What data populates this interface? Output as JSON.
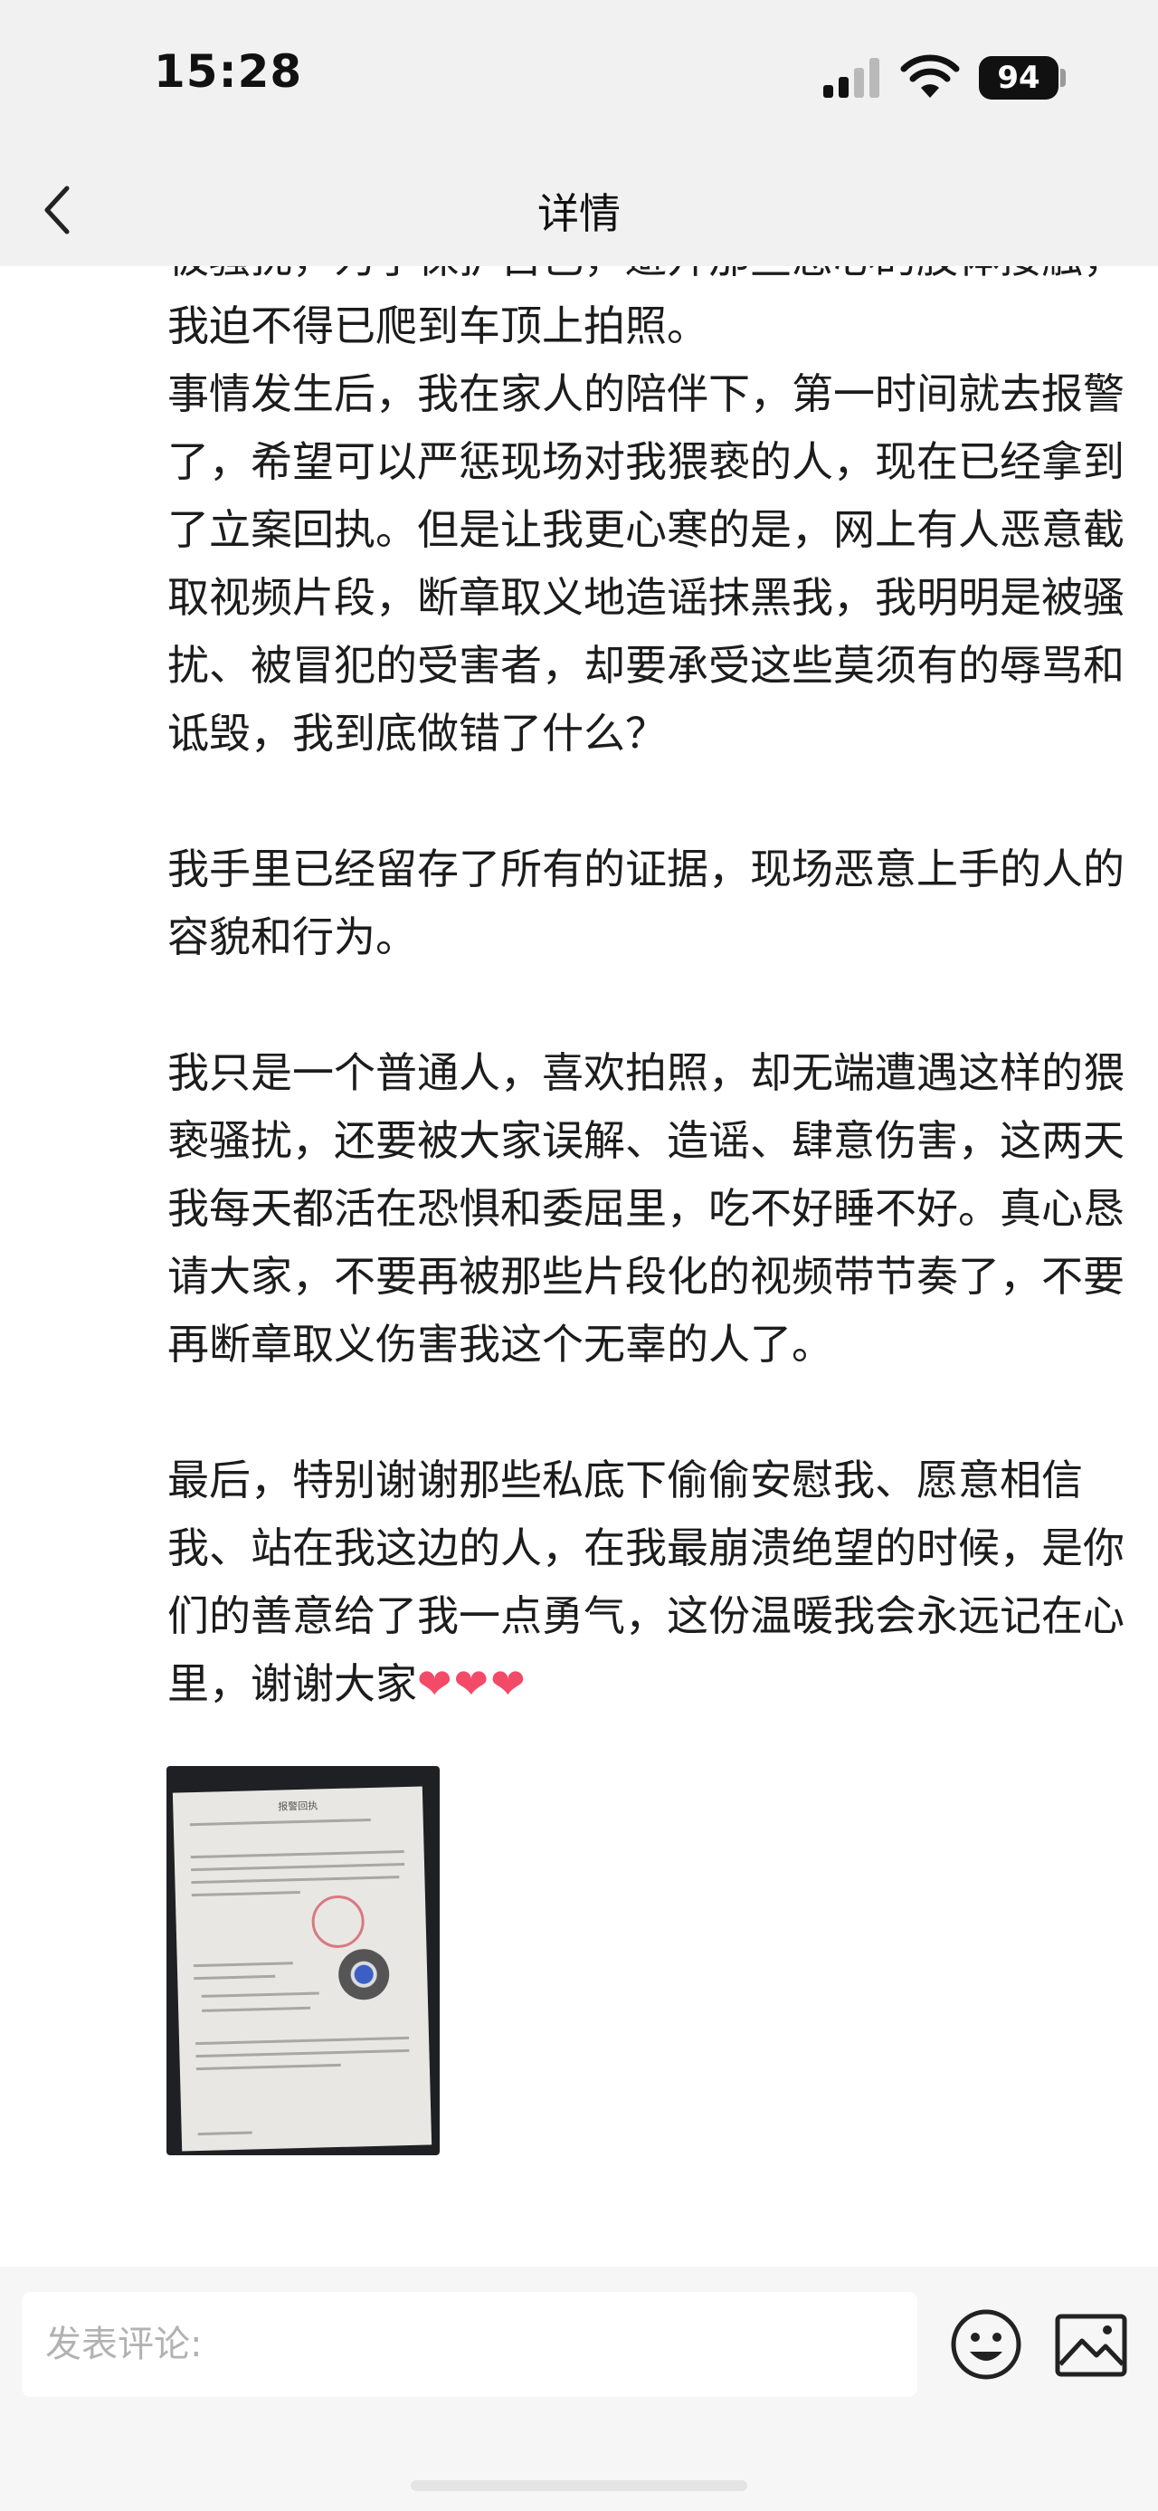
{
  "status_bar": {
    "time": "15:28",
    "battery": "94",
    "icons": [
      "signal-icon",
      "wifi-icon",
      "battery-icon"
    ]
  },
  "nav": {
    "title": "详情",
    "back_icon": "chevron-left-icon"
  },
  "post": {
    "paragraphs": [
      "被骚扰，为了保护自己，避开那些恶心的肢体接触，我迫不得已爬到车顶上拍照。",
      "事情发生后，我在家人的陪伴下，第一时间就去报警了，希望可以严惩现场对我猥亵的人，现在已经拿到了立案回执。但是让我更心寒的是，网上有人恶意截取视频片段，断章取义地造谣抹黑我，我明明是被骚扰、被冒犯的受害者，却要承受这些莫须有的辱骂和诋毁，我到底做错了什么？",
      "我手里已经留存了所有的证据，现场恶意上手的人的容貌和行为。",
      "我只是一个普通人，喜欢拍照，却无端遭遇这样的猥亵骚扰，还要被大家误解、造谣、肆意伤害，这两天我每天都活在恐惧和委屈里，吃不好睡不好。真心恳请大家，不要再被那些片段化的视频带节奏了，不要再断章取义伤害我这个无辜的人了。",
      "最后，特别谢谢那些私底下偷偷安慰我、愿意相信我、站在我这边的人，在我最崩溃绝望的时候，是你们的善意给了我一点勇气，这份温暖我会永远记在心里，谢谢大家"
    ],
    "hearts": "❤❤❤",
    "image": {
      "kind": "police-report-receipt-photo",
      "heading": "报警回执"
    }
  },
  "comment_bar": {
    "placeholder": "发表评论:",
    "emoji_icon": "emoji-icon",
    "image_icon": "image-icon"
  }
}
